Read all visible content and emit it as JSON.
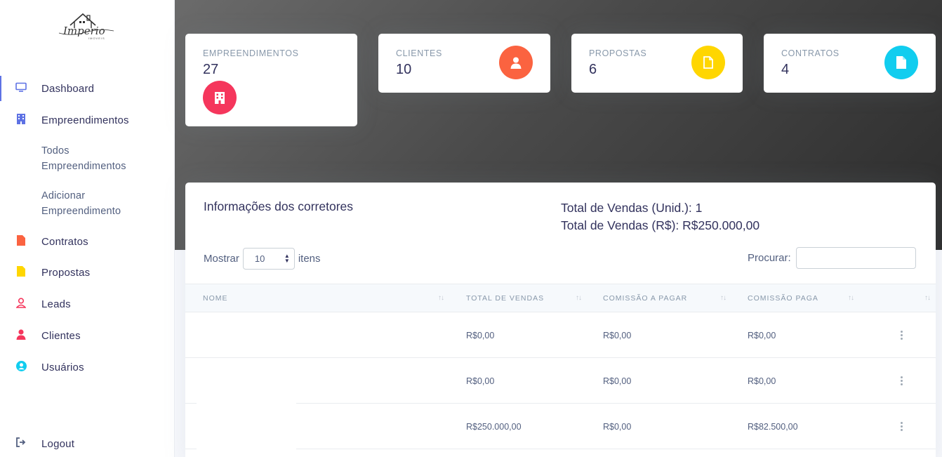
{
  "brand": {
    "logo_text": "Imperio",
    "logo_subtext": "IMOVEIS"
  },
  "sidebar": {
    "items": [
      {
        "label": "Dashboard",
        "icon": "monitor-icon",
        "color": "#5e72e4"
      },
      {
        "label": "Empreendimentos",
        "icon": "building-icon",
        "color": "#5e72e4"
      },
      {
        "label": "Contratos",
        "icon": "file-icon",
        "color": "#fb6340"
      },
      {
        "label": "Propostas",
        "icon": "file-icon",
        "color": "#ffd600"
      },
      {
        "label": "Leads",
        "icon": "user-outline-icon",
        "color": "#f5365c"
      },
      {
        "label": "Clientes",
        "icon": "user-icon",
        "color": "#f5365c"
      },
      {
        "label": "Usuários",
        "icon": "user-circle-icon",
        "color": "#11cdef"
      }
    ],
    "subitems": [
      {
        "line1": "Todos",
        "line2": "Empreendimentos"
      },
      {
        "line1": "Adicionar",
        "line2": "Empreendimento"
      }
    ],
    "logout": "Logout"
  },
  "stats": [
    {
      "title": "EMPREENDIMENTOS",
      "value": "27",
      "icon": "building-icon",
      "color": "#f5365c"
    },
    {
      "title": "CLIENTES",
      "value": "10",
      "icon": "user-icon",
      "color": "#fb6340"
    },
    {
      "title": "PROPOSTAS",
      "value": "6",
      "icon": "file-icon",
      "color": "#ffd600"
    },
    {
      "title": "CONTRATOS",
      "value": "4",
      "icon": "file-icon",
      "color": "#11cdef"
    }
  ],
  "main": {
    "title": "Informações dos corretores",
    "total_units": "Total de Vendas (Unid.): 1",
    "total_value": "Total de Vendas (R$): R$250.000,00",
    "show_label": "Mostrar",
    "show_value": "10",
    "items_label": "itens",
    "search_label": "Procurar:",
    "columns": [
      "NOME",
      "TOTAL DE VENDAS",
      "COMISSÃO A PAGAR",
      "COMISSÃO PAGA"
    ],
    "rows": [
      {
        "name": "",
        "total": "R$0,00",
        "to_pay": "R$0,00",
        "paid": "R$0,00"
      },
      {
        "name": "",
        "total": "R$0,00",
        "to_pay": "R$0,00",
        "paid": "R$0,00"
      },
      {
        "name": "",
        "total": "R$250.000,00",
        "to_pay": "R$0,00",
        "paid": "R$82.500,00"
      }
    ]
  }
}
